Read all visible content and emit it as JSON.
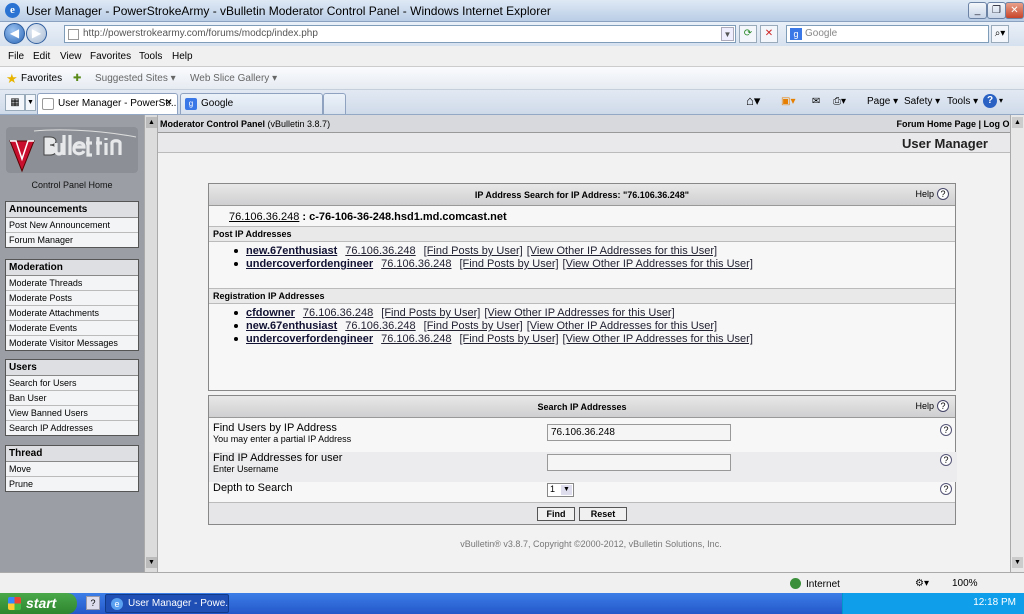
{
  "window": {
    "title": "User Manager - PowerStrokeArmy - vBulletin Moderator Control Panel - Windows Internet Explorer"
  },
  "address": {
    "url": "http://powerstrokearmy.com/forums/modcp/index.php",
    "search_placeholder": "Google"
  },
  "menu": [
    "File",
    "Edit",
    "View",
    "Favorites",
    "Tools",
    "Help"
  ],
  "favbar": {
    "favorites": "Favorites",
    "suggested": "Suggested Sites ▾",
    "webslice": "Web Slice Gallery ▾"
  },
  "tabs": [
    {
      "label": "User Manager - PowerStr..."
    },
    {
      "label": "Google"
    }
  ],
  "commandbar": {
    "page": "Page ▾",
    "safety": "Safety ▾",
    "tools": "Tools ▾"
  },
  "sidebar": {
    "control_panel_home": "Control Panel Home",
    "groups": [
      {
        "title": "Announcements",
        "items": [
          "Post New Announcement",
          "Forum Manager"
        ]
      },
      {
        "title": "Moderation",
        "items": [
          "Moderate Threads",
          "Moderate Posts",
          "Moderate Attachments",
          "Moderate Events",
          "Moderate Visitor Messages"
        ]
      },
      {
        "title": "Users",
        "items": [
          "Search for Users",
          "Ban User",
          "View Banned Users",
          "Search IP Addresses"
        ]
      },
      {
        "title": "Thread",
        "items": [
          "Move",
          "Prune"
        ]
      }
    ]
  },
  "header": {
    "panel_name": "Moderator Control Panel",
    "version": "(vBulletin 3.8.7)",
    "links": "Forum Home Page | Log Out",
    "page_title": "User Manager"
  },
  "ip_search": {
    "title": "IP Address Search for IP Address: \"76.106.36.248\"",
    "help": "Help",
    "ip": "76.106.36.248",
    "hostname": ": c-76-106-36-248.hsd1.md.comcast.net",
    "post_heading": "Post IP Addresses",
    "post_rows": [
      {
        "user": "new.67enthusiast",
        "ip": "76.106.36.248",
        "find": "[Find Posts by User]",
        "view": "[View Other IP Addresses for this User]"
      },
      {
        "user": "undercoverfordengineer",
        "ip": "76.106.36.248",
        "find": "[Find Posts by User]",
        "view": "[View Other IP Addresses for this User]"
      }
    ],
    "reg_heading": "Registration IP Addresses",
    "reg_rows": [
      {
        "user": "cfdowner",
        "ip": "76.106.36.248",
        "find": "[Find Posts by User]",
        "view": "[View Other IP Addresses for this User]"
      },
      {
        "user": "new.67enthusiast",
        "ip": "76.106.36.248",
        "find": "[Find Posts by User]",
        "view": "[View Other IP Addresses for this User]"
      },
      {
        "user": "undercoverfordengineer",
        "ip": "76.106.36.248",
        "find": "[Find Posts by User]",
        "view": "[View Other IP Addresses for this User]"
      }
    ]
  },
  "search_form": {
    "title": "Search IP Addresses",
    "help": "Help",
    "find_users_label": "Find Users by IP Address",
    "find_users_hint": "You may enter a partial IP Address",
    "find_users_value": "76.106.36.248",
    "find_ips_label": "Find IP Addresses for user",
    "find_ips_hint": "Enter Username",
    "find_ips_value": "",
    "depth_label": "Depth to Search",
    "depth_value": "1",
    "find_button": "Find",
    "reset_button": "Reset"
  },
  "footer": "vBulletin® v3.8.7, Copyright ©2000-2012, vBulletin Solutions, Inc.",
  "status": {
    "zone": "Internet",
    "zoom": "100%"
  },
  "taskbar": {
    "start": "start",
    "task": "User Manager - Powe...",
    "clock": "12:18 PM"
  }
}
